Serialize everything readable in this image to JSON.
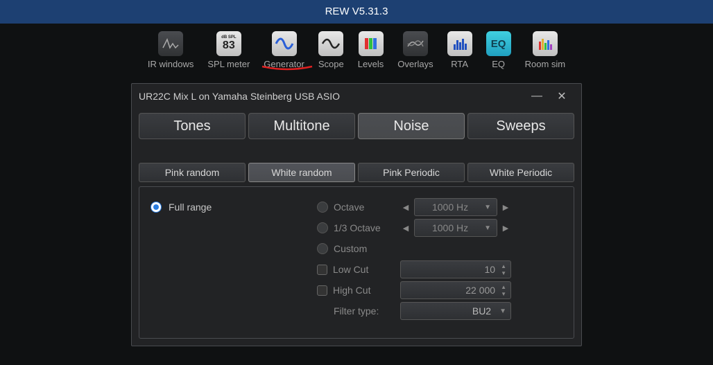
{
  "app_title": "REW V5.31.3",
  "toolbar": [
    {
      "id": "ir-windows",
      "label": "IR windows"
    },
    {
      "id": "spl-meter",
      "label": "SPL meter"
    },
    {
      "id": "generator",
      "label": "Generator",
      "highlighted": true
    },
    {
      "id": "scope",
      "label": "Scope"
    },
    {
      "id": "levels",
      "label": "Levels"
    },
    {
      "id": "overlays",
      "label": "Overlays"
    },
    {
      "id": "rta",
      "label": "RTA"
    },
    {
      "id": "eq",
      "label": "EQ"
    },
    {
      "id": "room-sim",
      "label": "Room sim"
    }
  ],
  "window": {
    "title": "UR22C Mix L on Yamaha Steinberg USB ASIO",
    "main_tabs": [
      "Tones",
      "Multitone",
      "Noise",
      "Sweeps"
    ],
    "main_tab_active": 2,
    "sub_tabs": [
      "Pink random",
      "White random",
      "Pink Periodic",
      "White Periodic"
    ],
    "sub_tab_active": 1,
    "range": {
      "full_label": "Full range",
      "octave_label": "Octave",
      "octave_value": "1000 Hz",
      "third_label": "1/3 Octave",
      "third_value": "1000 Hz",
      "custom_label": "Custom",
      "lowcut_label": "Low Cut",
      "lowcut_value": "10",
      "highcut_label": "High Cut",
      "highcut_value": "22 000",
      "filter_label": "Filter type:",
      "filter_value": "BU2"
    }
  }
}
